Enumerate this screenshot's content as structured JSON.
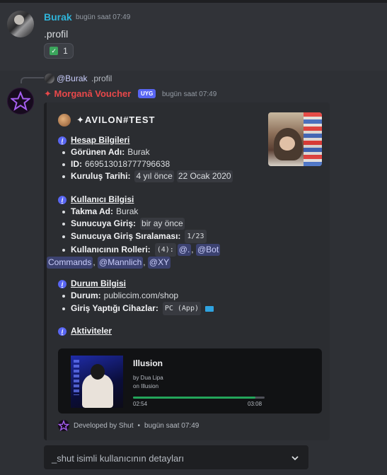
{
  "message1": {
    "username": "Burak",
    "timestamp": "bugün saat 07:49",
    "content": ".profil",
    "reaction": {
      "emoji": "check-icon",
      "count": "1"
    }
  },
  "message2": {
    "reply": {
      "mention": "@Burak",
      "text": ".profil"
    },
    "username": "✦ Morganâ Voucher",
    "badge": "UYG",
    "timestamp": "bugün saat 07:49",
    "embed": {
      "author": "✦AVILON#TEST",
      "sections": {
        "hesap": {
          "title": "Hesap Bilgileri",
          "gorunen_label": "Görünen Adı:",
          "gorunen_value": "Burak",
          "id_label": "ID:",
          "id_value": "669513018777796638",
          "kurulus_label": "Kuruluş Tarihi:",
          "kurulus_rel": "4 yıl önce",
          "kurulus_date": "22 Ocak 2020"
        },
        "kullanici": {
          "title": "Kullanıcı Bilgisi",
          "takma_label": "Takma Ad:",
          "takma_value": "Burak",
          "giris_label": "Sunucuya Giriş:",
          "giris_value": "bir ay önce",
          "sira_label": "Sunucuya Giriş Sıralaması:",
          "sira_value": "1/23",
          "roller_label": "Kullanıcının Rolleri:",
          "roller_count": "(4):",
          "roles": [
            "@.",
            "@Bot Commands",
            "@Mannlich",
            "@XY"
          ]
        },
        "durum": {
          "title": "Durum Bilgisi",
          "durum_label": "Durum:",
          "durum_value": "publiccim.com/shop",
          "cihaz_label": "Giriş Yaptığı Cihazlar:",
          "cihaz_value": "PC (App)"
        },
        "aktivite": {
          "title": "Aktiviteler"
        }
      },
      "spotify": {
        "title": "Illusion",
        "by": "by Dua Lipa",
        "on": "on Illusion",
        "elapsed": "02:54",
        "total": "03:08",
        "progress": 0.93
      },
      "footer": {
        "text": "Developed by Shut",
        "separator": "•",
        "timestamp": "bugün saat 07:49"
      }
    }
  },
  "dropdown": {
    "placeholder": "_shut isimli kullanıcının detayları"
  },
  "colors": {
    "accent": "#5865f2",
    "username1": "#2fb4d9",
    "username2": "#e8484a",
    "progress": "#23a55a"
  }
}
